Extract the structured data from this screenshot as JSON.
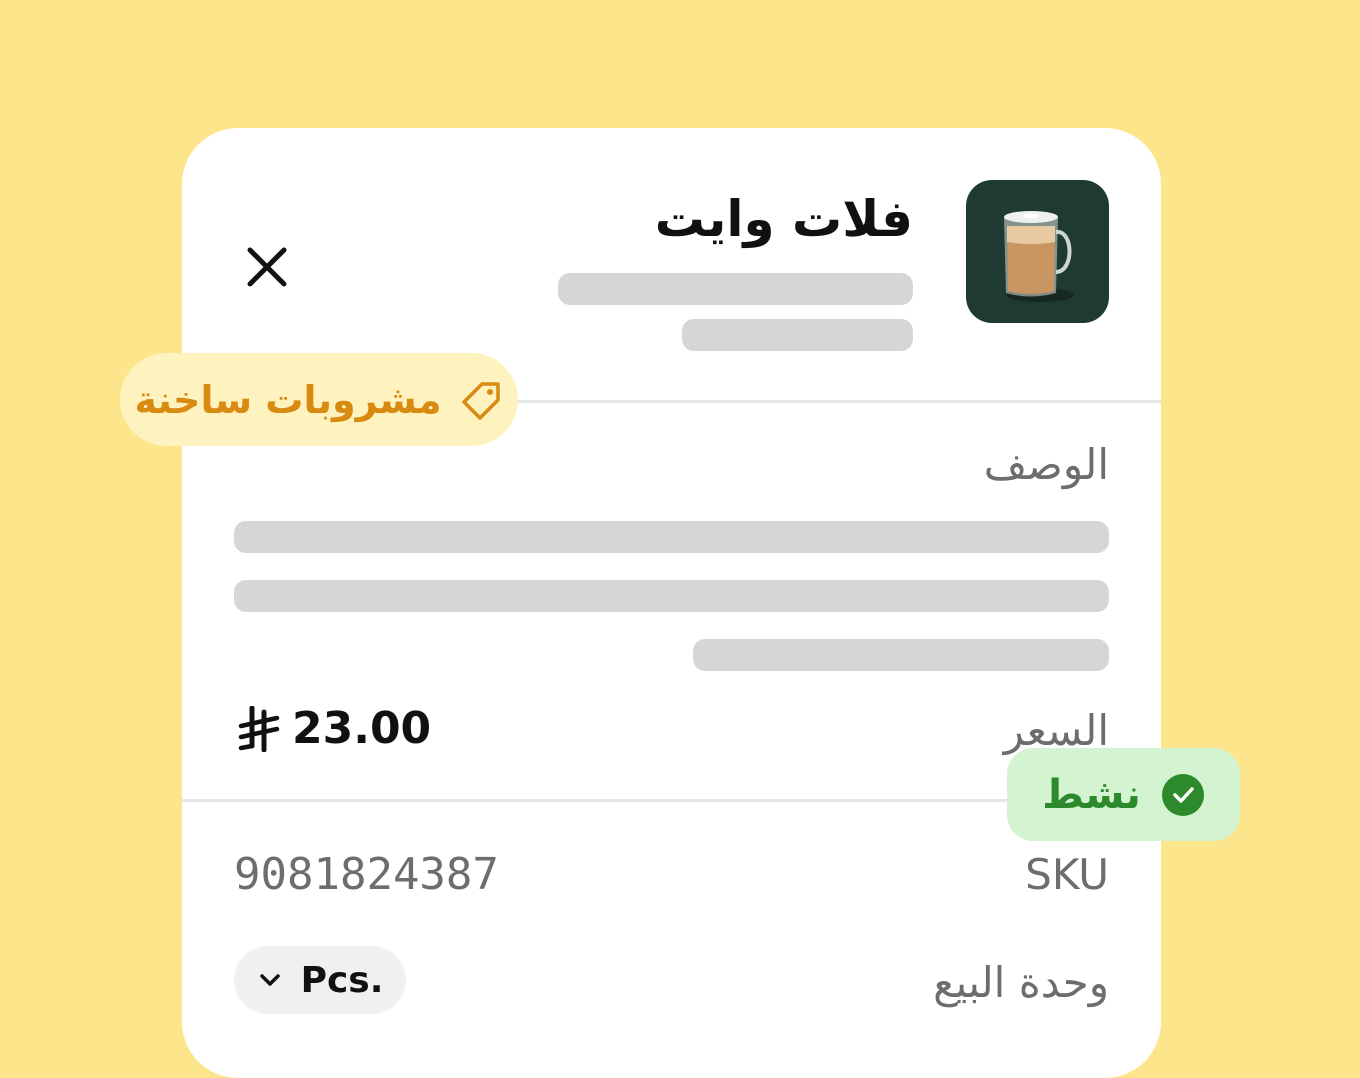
{
  "product": {
    "name": "فلات وايت",
    "image": "mug-icon"
  },
  "category_tag": {
    "label": "مشروبات ساخنة",
    "icon": "tag-icon",
    "color": "#d98a10"
  },
  "description": {
    "label": "الوصف"
  },
  "price": {
    "label": "السعر",
    "value": "23.00",
    "currency_icon": "riyal-icon"
  },
  "status": {
    "label": "نشط",
    "icon": "check-circle-icon",
    "color": "#2c8a2c"
  },
  "sku": {
    "label": "SKU",
    "value": "9081824387"
  },
  "sale_unit": {
    "label": "وحدة البيع",
    "value": "Pcs.",
    "icon": "chevron-down-icon"
  },
  "colors": {
    "background": "#fde58c",
    "thumbnail": "#1f3a33"
  }
}
